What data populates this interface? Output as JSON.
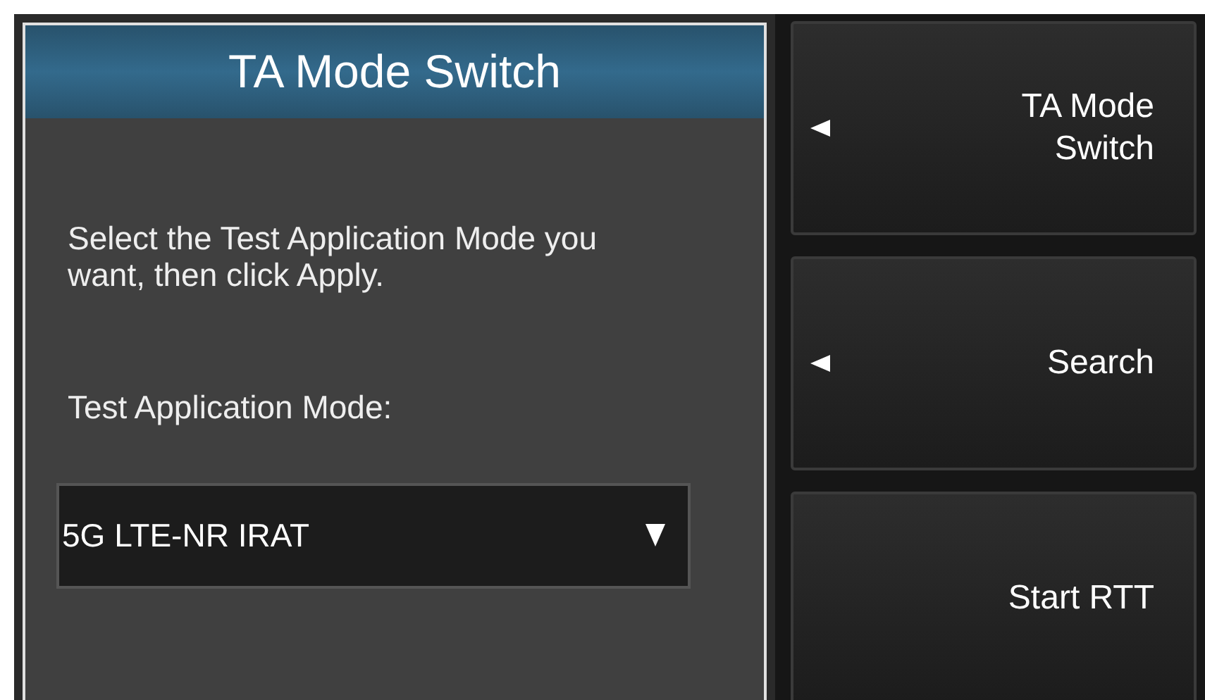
{
  "dialog": {
    "title": "TA Mode Switch",
    "description": "Select the Test Application Mode you want, then click Apply.",
    "field_label": "Test Application Mode:",
    "dropdown": {
      "value": "5G LTE-NR IRAT"
    }
  },
  "softkeys": [
    {
      "label": "TA Mode Switch",
      "submenu": true
    },
    {
      "label": "Search",
      "submenu": true
    },
    {
      "label": "Start RTT",
      "submenu": false
    }
  ]
}
